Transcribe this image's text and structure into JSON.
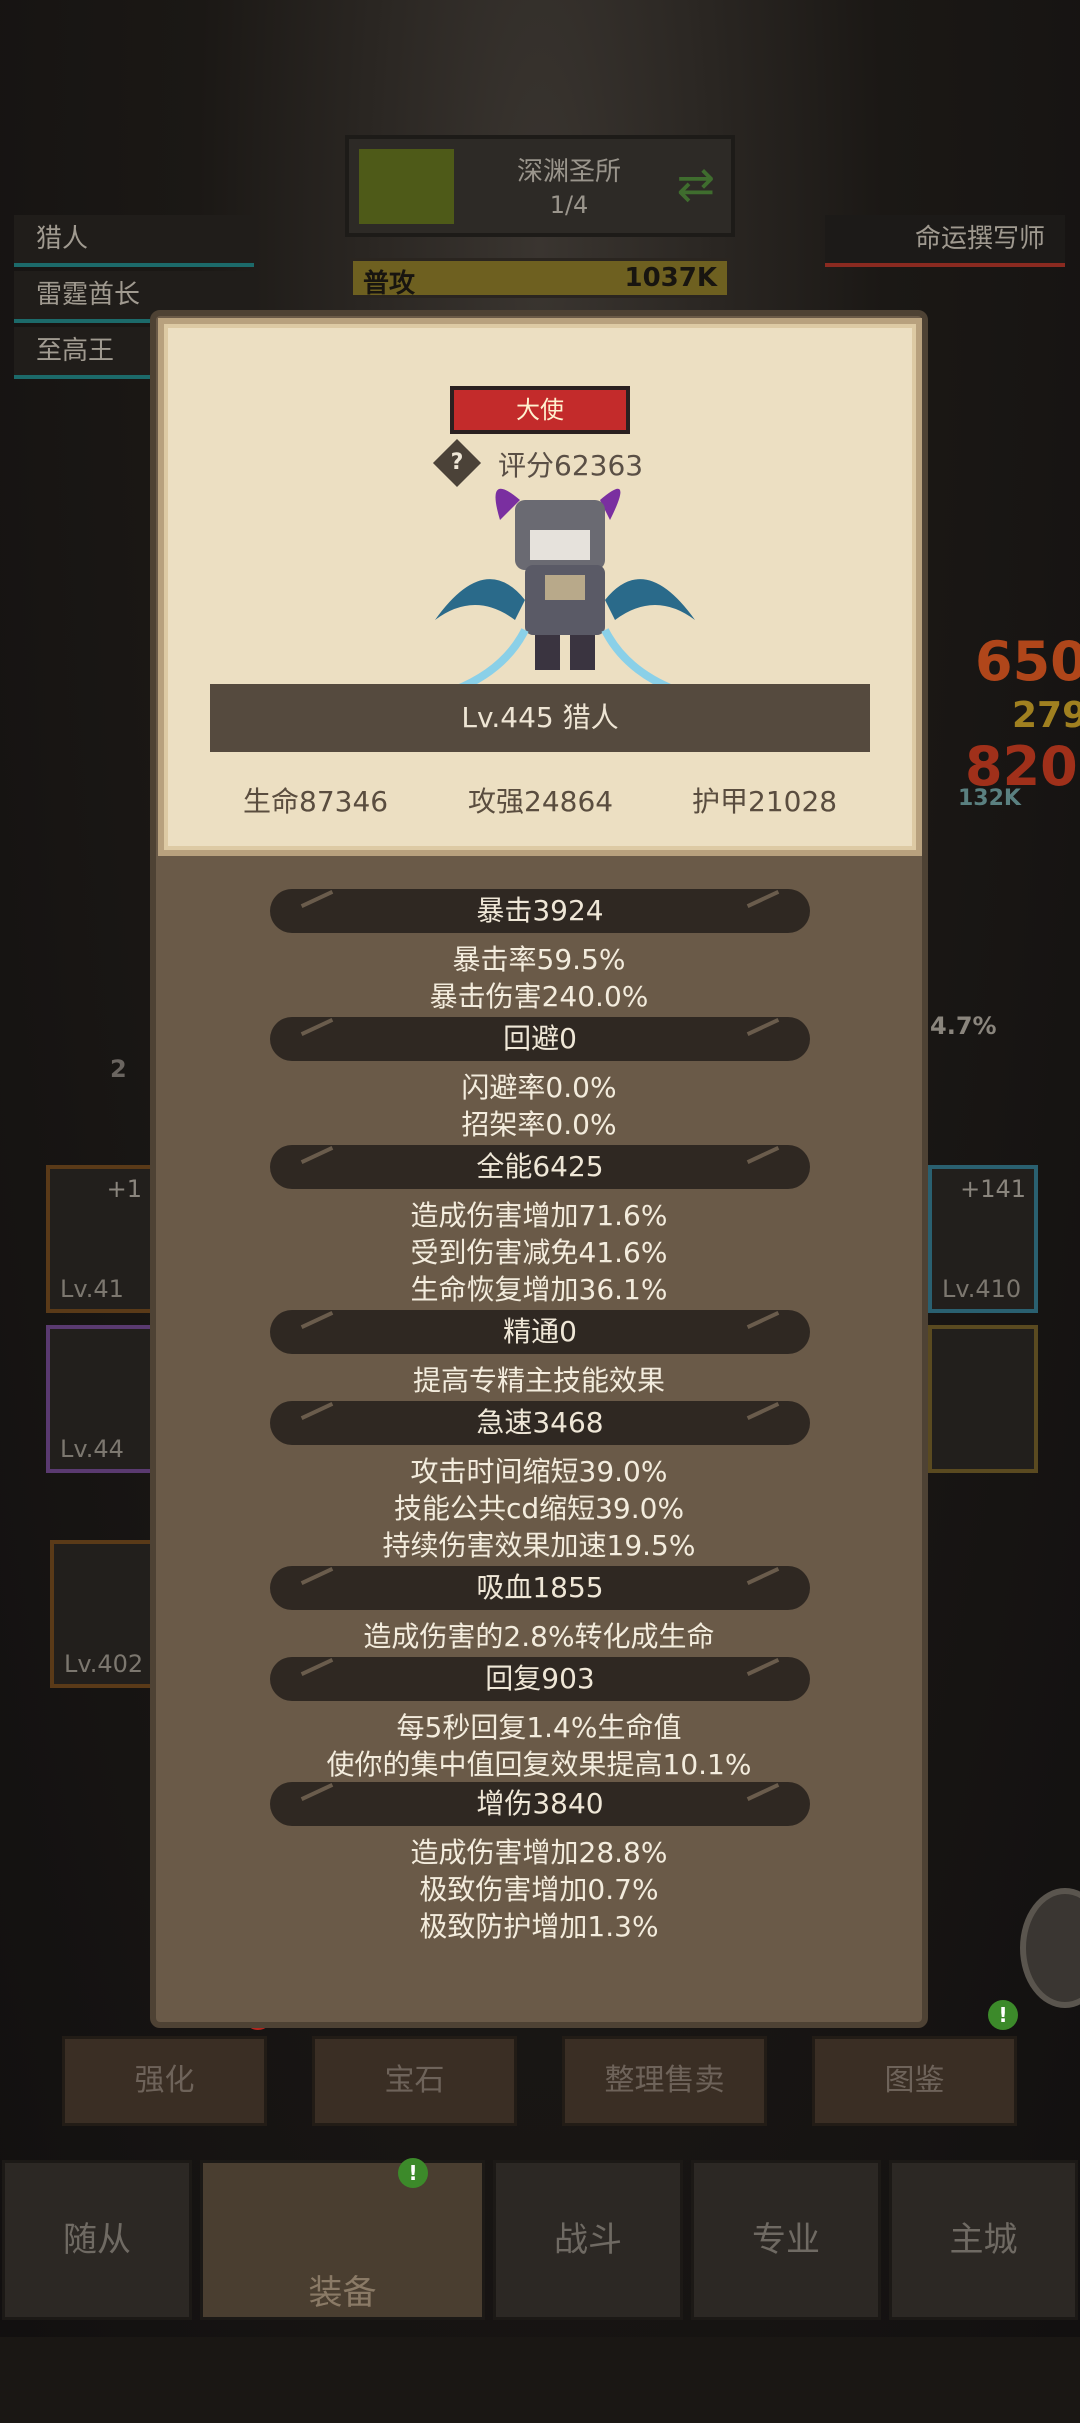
{
  "background": {
    "zone": {
      "name": "深渊圣所",
      "progress": "1/4"
    },
    "attack": {
      "label": "普攻",
      "value": "1037K"
    },
    "left_list": [
      "猎人",
      "雷霆酋长",
      "至高王"
    ],
    "right_tag": "命运撰写师",
    "side_numbers": [
      "650",
      "279",
      "820"
    ],
    "side_small": [
      "132K",
      "4.7%",
      "2"
    ],
    "slots": [
      {
        "lv": "Lv.41",
        "plus": "+1"
      },
      {
        "lv": "Lv.44",
        "plus": ""
      },
      {
        "lv": "Lv.402",
        "plus": ""
      },
      {
        "lv": "Lv.410",
        "plus": "+141"
      }
    ]
  },
  "popup": {
    "rank": "大使",
    "help_icon": "?",
    "score": "评分62363",
    "hero_banner": "Lv.445 猎人",
    "stats": [
      "生命87346",
      "攻强24864",
      "护甲21028"
    ],
    "sections": [
      {
        "title": "暴击3924",
        "lines": [
          "暴击率59.5%",
          "暴击伤害240.0%"
        ]
      },
      {
        "title": "回避0",
        "lines": [
          "闪避率0.0%",
          "招架率0.0%"
        ]
      },
      {
        "title": "全能6425",
        "lines": [
          "造成伤害增加71.6%",
          "受到伤害减免41.6%",
          "生命恢复增加36.1%"
        ]
      },
      {
        "title": "精通0",
        "lines": [
          "提高专精主技能效果"
        ]
      },
      {
        "title": "急速3468",
        "lines": [
          "攻击时间缩短39.0%",
          "技能公共cd缩短39.0%",
          "持续伤害效果加速19.5%"
        ]
      },
      {
        "title": "吸血1855",
        "lines": [
          "造成伤害的2.8%转化成生命"
        ]
      },
      {
        "title": "回复903",
        "lines": [
          "每5秒回复1.4%生命值",
          "使你的集中值回复效果提高10.1%"
        ]
      },
      {
        "title": "增伤3840",
        "lines": [
          "造成伤害增加28.8%",
          "极致伤害增加0.7%",
          "极致防护增加1.3%"
        ]
      }
    ]
  },
  "function_buttons": [
    "强化",
    "宝石",
    "整理售卖",
    "图鉴"
  ],
  "nav_tabs": [
    "随从",
    "装备",
    "战斗",
    "专业",
    "主城"
  ],
  "colors": {
    "rank_red": "#c32b2b",
    "panel": "#6a5a48",
    "parchment": "#ecdfc2"
  }
}
